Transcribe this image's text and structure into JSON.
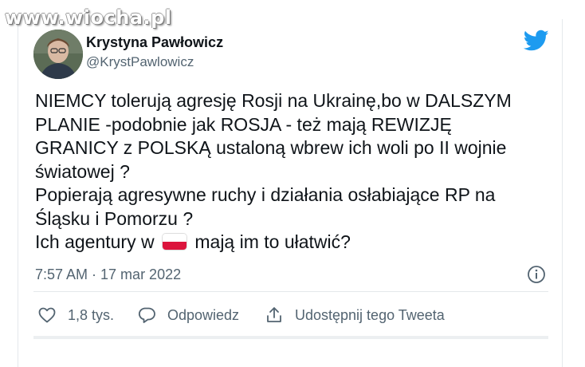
{
  "watermark": "www.wiocha.pl",
  "user": {
    "name": "Krystyna Pawłowicz",
    "handle": "@KrystPawlowicz"
  },
  "tweet": {
    "lines": [
      "NIEMCY tolerują agresję Rosji na Ukrainę,bo w DALSZYM",
      "PLANIE -podobnie jak ROSJA - też mają REWIZJĘ",
      "GRANICY z POLSKĄ ustaloną wbrew ich woli po II wojnie",
      "światowej ?",
      "Popierają agresywne ruchy i działania osłabiające RP na",
      "Śląsku i Pomorzu ?"
    ],
    "last_line_before": "Ich agentury w",
    "last_line_after": "mają im to ułatwić?",
    "flag_icon": "poland-flag-emoji",
    "timestamp": "7:57 AM · 17 mar 2022"
  },
  "actions": {
    "like_count": "1,8 tys.",
    "reply_label": "Odpowiedz",
    "share_label": "Udostępnij tego Tweeta"
  },
  "colors": {
    "twitter_blue": "#1d9bf0",
    "secondary_text": "#536471",
    "flag_red": "#dc143c"
  }
}
